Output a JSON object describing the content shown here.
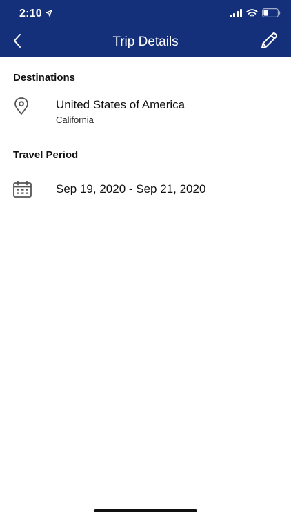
{
  "status_bar": {
    "time": "2:10",
    "location_icon": "location-arrow-icon",
    "signal_icon": "cellular-signal-icon",
    "wifi_icon": "wifi-icon",
    "battery_icon": "battery-icon"
  },
  "header": {
    "title": "Trip Details",
    "back_icon": "chevron-left-icon",
    "edit_icon": "pencil-icon",
    "background_color": "#14307a"
  },
  "destinations": {
    "heading": "Destinations",
    "icon": "map-pin-icon",
    "items": [
      {
        "country": "United States of America",
        "region": "California"
      }
    ]
  },
  "travel_period": {
    "heading": "Travel Period",
    "icon": "calendar-icon",
    "date_range": "Sep 19, 2020 - Sep 21, 2020"
  }
}
